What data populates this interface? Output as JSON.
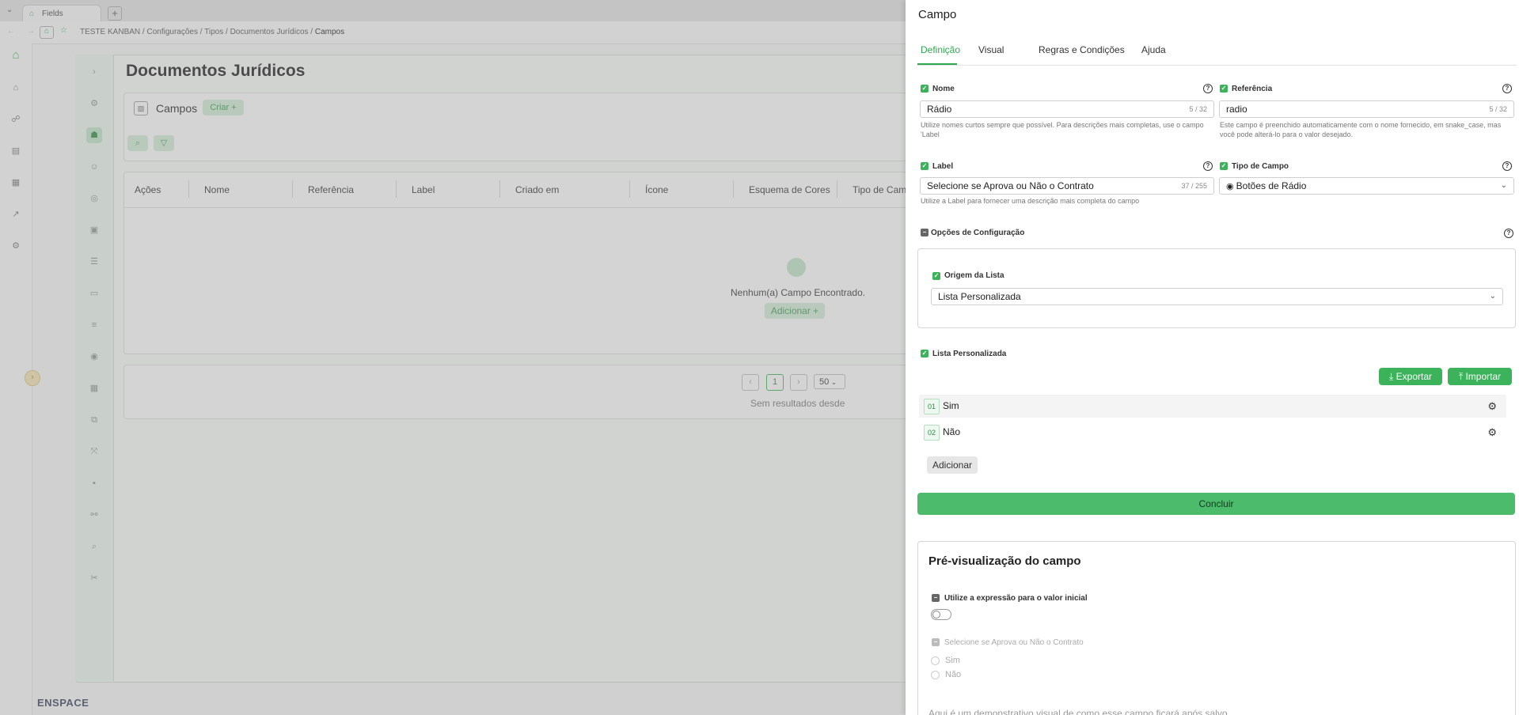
{
  "browser": {
    "tab_title": "Fields",
    "new_tab": "+",
    "breadcrumb": [
      "TESTE KANBAN",
      "Configurações",
      "Tipos",
      "Documentos Jurídicos",
      "Campos"
    ],
    "breadcrumb_sep": "/"
  },
  "background": {
    "page_title": "Documentos Jurídicos",
    "section_title": "Campos",
    "create_button": "Criar +",
    "table_headers": [
      "Ações",
      "Nome",
      "Referência",
      "Label",
      "Criado em",
      "Ícone",
      "Esquema de Cores",
      "Tipo de Cam"
    ],
    "empty_message": "Nenhum(a) Campo Encontrado.",
    "add_button": "Adicionar +",
    "pagination": {
      "page": "1",
      "page_size": "50"
    },
    "no_results": "Sem resultados desde",
    "logo": "ENSPACE"
  },
  "drawer": {
    "title": "Campo",
    "tabs": [
      "Definição",
      "Visual",
      "Regras e Condições",
      "Ajuda"
    ],
    "active_tab": "Definição",
    "help_glyph": "?",
    "name": {
      "label": "Nome",
      "value": "Rádio",
      "count": "5 / 32",
      "hint": "Utilize nomes curtos sempre que possível. Para descrições mais completas, use o campo 'Label"
    },
    "reference": {
      "label": "Referência",
      "value": "radio",
      "count": "5 / 32",
      "hint": "Este campo é preenchido automaticamente com o nome fornecido, em snake_case, mas você pode alterá-lo para o valor desejado."
    },
    "label_field": {
      "label": "Label",
      "value": "Selecione se Aprova ou Não o Contrato",
      "count": "37 / 255",
      "hint": "Utilize a Label para fornecer uma descrição mais completa do campo"
    },
    "field_type": {
      "label": "Tipo de Campo",
      "value": "Botões de Rádio"
    },
    "config_options": {
      "label": "Opções de Configuração",
      "list_origin_label": "Origem da Lista",
      "list_origin_value": "Lista Personalizada"
    },
    "custom_list": {
      "label": "Lista Personalizada",
      "export_button": "Exportar",
      "import_button": "Importar",
      "items": [
        {
          "num": "01",
          "label": "Sim"
        },
        {
          "num": "02",
          "label": "Não"
        }
      ],
      "add_button": "Adicionar"
    },
    "conclude_button": "Concluir",
    "preview": {
      "title": "Pré-visualização do campo",
      "expression_label": "Utilize a expressão para o valor inicial",
      "expression_enabled": false,
      "field_label": "Selecione se Aprova ou Não o Contrato",
      "options": [
        "Sim",
        "Não"
      ],
      "footer": "Aqui é um demonstrativo visual de como esse campo ficará após salvo"
    }
  },
  "colors": {
    "brand_green": "#3cb35a",
    "active_tab": "#2fa84f",
    "overlay": "rgba(150,150,150,0.38)"
  }
}
